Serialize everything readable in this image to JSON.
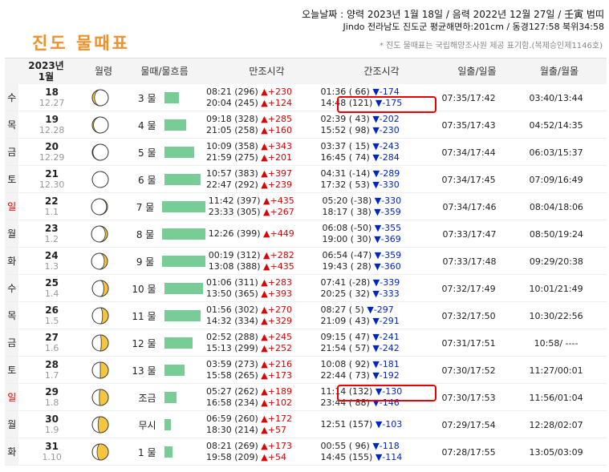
{
  "header": {
    "today": "오늘날짜 : 양력 2023년 1월 18일 / 음력 2022년 12월 27일 / 壬寅 범띠",
    "location": "Jindo 전라남도 진도군 평균해면하:201cm / 동경127:58 북위34:58",
    "title": "진도 물때표",
    "note": "* 진도 물때표는 국립해양조사원 제공 표기함.(복제승인제1146호)"
  },
  "columns": {
    "date": "2023년\n1월",
    "moon": "월령",
    "tide": "물때/물흐름",
    "high": "만조시각",
    "low": "간조시각",
    "sun": "일출/일몰",
    "moonrise": "월출/월몰"
  },
  "colors": {
    "bar": "#78cc96",
    "up": "#dd0000",
    "down": "#0024c8",
    "title": "#f0902a",
    "highlight": "#ee0000"
  },
  "rows": [
    {
      "dow": "수",
      "sunday": false,
      "day": "18",
      "lunar": "12.27",
      "phase": 0.93,
      "tide": "3 물",
      "flow": 0.3,
      "high": [
        {
          "t": "08:21 (296)",
          "d": "▲+230"
        },
        {
          "t": "20:04 (245)",
          "d": "▲+124"
        }
      ],
      "low": [
        {
          "t": "01:36 ( 66)",
          "d": "▼-174"
        },
        {
          "t": "14:48 (121)",
          "d": "▼-175"
        }
      ],
      "sun": "07:35/17:42",
      "moon": "03:40/13:44"
    },
    {
      "dow": "목",
      "sunday": false,
      "day": "19",
      "lunar": "12.28",
      "phase": 0.96,
      "tide": "4 물",
      "flow": 0.45,
      "high": [
        {
          "t": "09:18 (328)",
          "d": "▲+285"
        },
        {
          "t": "21:05 (258)",
          "d": "▲+160"
        }
      ],
      "low": [
        {
          "t": "02:39 ( 43)",
          "d": "▼-202"
        },
        {
          "t": "15:52 ( 98)",
          "d": "▼-230"
        }
      ],
      "sun": "07:35/17:43",
      "moon": "04:52/14:35"
    },
    {
      "dow": "금",
      "sunday": false,
      "day": "20",
      "lunar": "12.29",
      "phase": 0.98,
      "tide": "5 물",
      "flow": 0.62,
      "high": [
        {
          "t": "10:09 (358)",
          "d": "▲+343"
        },
        {
          "t": "21:59 (275)",
          "d": "▲+201"
        }
      ],
      "low": [
        {
          "t": "03:37 ( 15)",
          "d": "▼-243"
        },
        {
          "t": "16:45 ( 74)",
          "d": "▼-284"
        }
      ],
      "sun": "07:34/17:44",
      "moon": "06:03/15:37"
    },
    {
      "dow": "토",
      "sunday": false,
      "day": "21",
      "lunar": "12.30",
      "phase": 0.0,
      "tide": "6 물",
      "flow": 0.75,
      "high": [
        {
          "t": "10:57 (383)",
          "d": "▲+397"
        },
        {
          "t": "22:47 (292)",
          "d": "▲+239"
        }
      ],
      "low": [
        {
          "t": "04:31 (-14)",
          "d": "▼-289"
        },
        {
          "t": "17:32 ( 53)",
          "d": "▼-330"
        }
      ],
      "sun": "07:34/17:45",
      "moon": "07:09/16:49"
    },
    {
      "dow": "일",
      "sunday": true,
      "day": "22",
      "lunar": "1.1",
      "phase": 0.03,
      "tide": "7 물",
      "flow": 0.92,
      "high": [
        {
          "t": "11:42 (397)",
          "d": "▲+435"
        },
        {
          "t": "23:33 (305)",
          "d": "▲+267"
        }
      ],
      "low": [
        {
          "t": "05:20 (-38)",
          "d": "▼-330"
        },
        {
          "t": "18:17 ( 38)",
          "d": "▼-359"
        }
      ],
      "sun": "07:34/17:46",
      "moon": "08:04/18:06"
    },
    {
      "dow": "월",
      "sunday": false,
      "day": "23",
      "lunar": "1.2",
      "phase": 0.07,
      "tide": "8 물",
      "flow": 0.92,
      "high": [
        {
          "t": "12:26 (399)",
          "d": "▲+449"
        }
      ],
      "low": [
        {
          "t": "06:08 (-50)",
          "d": "▼-355"
        },
        {
          "t": "19:00 ( 30)",
          "d": "▼-369"
        }
      ],
      "sun": "07:33/17:47",
      "moon": "08:50/19:24"
    },
    {
      "dow": "화",
      "sunday": false,
      "day": "24",
      "lunar": "1.3",
      "phase": 0.1,
      "tide": "9 물",
      "flow": 0.92,
      "high": [
        {
          "t": "00:19 (312)",
          "d": "▲+282"
        },
        {
          "t": "13:08 (388)",
          "d": "▲+435"
        }
      ],
      "low": [
        {
          "t": "06:54 (-47)",
          "d": "▼-359"
        },
        {
          "t": "19:43 ( 28)",
          "d": "▼-360"
        }
      ],
      "sun": "07:33/17:48",
      "moon": "09:29/20:38"
    },
    {
      "dow": "수",
      "sunday": false,
      "day": "25",
      "lunar": "1.4",
      "phase": 0.14,
      "tide": "10 물",
      "flow": 0.8,
      "high": [
        {
          "t": "01:06 (311)",
          "d": "▲+283"
        },
        {
          "t": "13:50 (365)",
          "d": "▲+393"
        }
      ],
      "low": [
        {
          "t": "07:41 (-28)",
          "d": "▼-339"
        },
        {
          "t": "20:25 ( 32)",
          "d": "▼-333"
        }
      ],
      "sun": "07:32/17:49",
      "moon": "10:01/21:49"
    },
    {
      "dow": "목",
      "sunday": false,
      "day": "26",
      "lunar": "1.5",
      "phase": 0.18,
      "tide": "11 물",
      "flow": 0.75,
      "high": [
        {
          "t": "01:56 (302)",
          "d": "▲+270"
        },
        {
          "t": "14:32 (334)",
          "d": "▲+329"
        }
      ],
      "low": [
        {
          "t": "08:27 (  5)",
          "d": "▼-297"
        },
        {
          "t": "21:09 ( 43)",
          "d": "▼-291"
        }
      ],
      "sun": "07:32/17:50",
      "moon": "10:30/22:56"
    },
    {
      "dow": "금",
      "sunday": false,
      "day": "27",
      "lunar": "1.6",
      "phase": 0.22,
      "tide": "12 물",
      "flow": 0.58,
      "high": [
        {
          "t": "02:52 (288)",
          "d": "▲+245"
        },
        {
          "t": "15:13 (299)",
          "d": "▲+252"
        }
      ],
      "low": [
        {
          "t": "09:15 ( 47)",
          "d": "▼-241"
        },
        {
          "t": "21:54 ( 57)",
          "d": "▼-242"
        }
      ],
      "sun": "07:31/17:51",
      "moon": "10:58/ ----"
    },
    {
      "dow": "토",
      "sunday": false,
      "day": "28",
      "lunar": "1.7",
      "phase": 0.25,
      "tide": "13 물",
      "flow": 0.42,
      "high": [
        {
          "t": "03:59 (273)",
          "d": "▲+216"
        },
        {
          "t": "15:58 (265)",
          "d": "▲+173"
        }
      ],
      "low": [
        {
          "t": "10:08 ( 92)",
          "d": "▼-181"
        },
        {
          "t": "22:44 ( 73)",
          "d": "▼-192"
        }
      ],
      "sun": "07:30/17:52",
      "moon": "11:27/00:01"
    },
    {
      "dow": "일",
      "sunday": true,
      "day": "29",
      "lunar": "1.8",
      "phase": 0.28,
      "tide": "조금",
      "flow": 0.25,
      "high": [
        {
          "t": "05:27 (262)",
          "d": "▲+189"
        },
        {
          "t": "16:58 (234)",
          "d": "▲+102"
        }
      ],
      "low": [
        {
          "t": "11:14 (132)",
          "d": "▼-130"
        },
        {
          "t": "23:44 ( 88)",
          "d": "▼-146"
        }
      ],
      "sun": "07:30/17:53",
      "moon": "11:56/01:04"
    },
    {
      "dow": "월",
      "sunday": false,
      "day": "30",
      "lunar": "1.9",
      "phase": 0.32,
      "tide": "무시",
      "flow": 0.14,
      "high": [
        {
          "t": "06:59 (260)",
          "d": "▲+172"
        },
        {
          "t": "18:30 (214)",
          "d": "▲+57"
        }
      ],
      "low": [
        {
          "t": "12:51 (157)",
          "d": "▼-103"
        }
      ],
      "sun": "07:29/17:54",
      "moon": "12:28/02:07"
    },
    {
      "dow": "화",
      "sunday": false,
      "day": "31",
      "lunar": "1.10",
      "phase": 0.35,
      "tide": "1 물",
      "flow": 0.16,
      "high": [
        {
          "t": "08:21 (269)",
          "d": "▲+173"
        },
        {
          "t": "19:58 (209)",
          "d": "▲+54"
        }
      ],
      "low": [
        {
          "t": "00:55 ( 96)",
          "d": "▼-118"
        },
        {
          "t": "14:45 (155)",
          "d": "▼-114"
        }
      ],
      "sun": "07:28/17:55",
      "moon": "13:05/03:09"
    }
  ]
}
